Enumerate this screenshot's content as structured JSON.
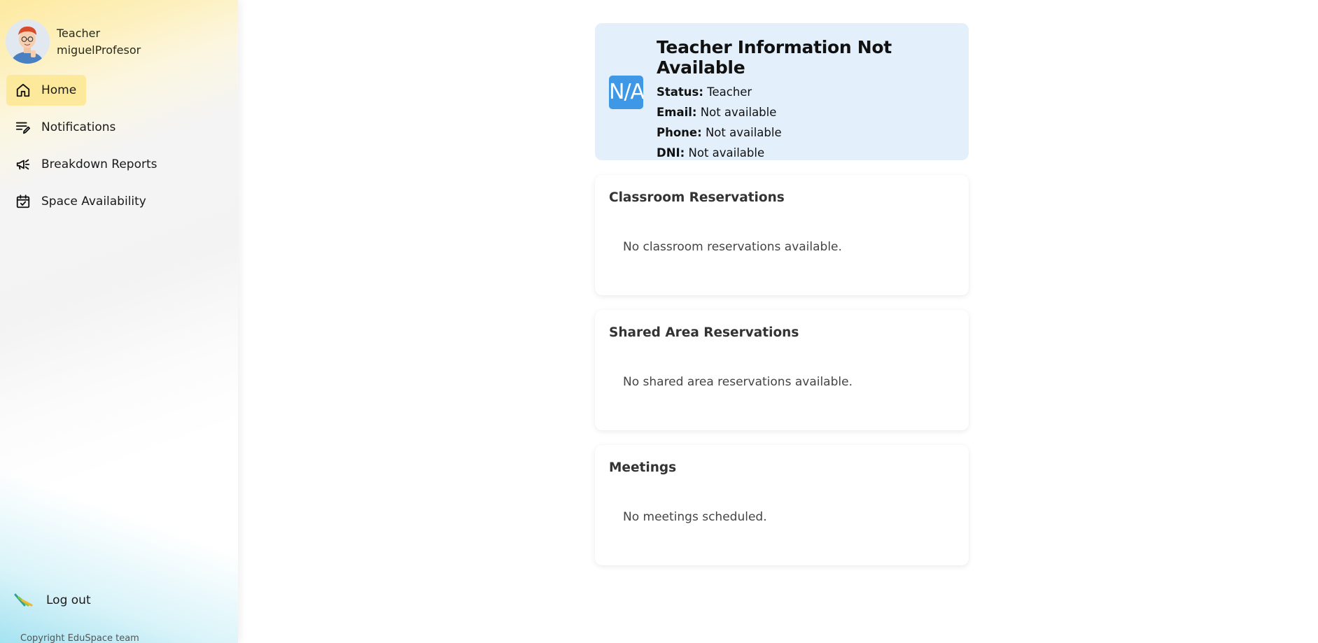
{
  "sidebar": {
    "profile": {
      "role": "Teacher",
      "username": "miguelProfesor"
    },
    "nav": [
      {
        "label": "Home",
        "icon": "home-icon",
        "active": true
      },
      {
        "label": "Notifications",
        "icon": "notifications-icon",
        "active": false
      },
      {
        "label": "Breakdown Reports",
        "icon": "megaphone-icon",
        "active": false
      },
      {
        "label": "Space Availability",
        "icon": "calendar-check-icon",
        "active": false
      }
    ],
    "logout_label": "Log out",
    "copyright": "Copyright EduSpace team"
  },
  "teacher_info": {
    "badge": "N/A",
    "title": "Teacher Information Not Available",
    "status_label": "Status:",
    "status_value": "Teacher",
    "email_label": "Email:",
    "email_value": "Not available",
    "phone_label": "Phone:",
    "phone_value": "Not available",
    "dni_label": "DNI:",
    "dni_value": "Not available"
  },
  "sections": [
    {
      "title": "Classroom Reservations",
      "empty": "No classroom reservations available."
    },
    {
      "title": "Shared Area Reservations",
      "empty": "No shared area reservations available."
    },
    {
      "title": "Meetings",
      "empty": "No meetings scheduled."
    }
  ],
  "colors": {
    "active_nav_bg": "#fde99b",
    "info_card_bg": "#e3f0fb",
    "badge_bg": "#3f98e6"
  }
}
